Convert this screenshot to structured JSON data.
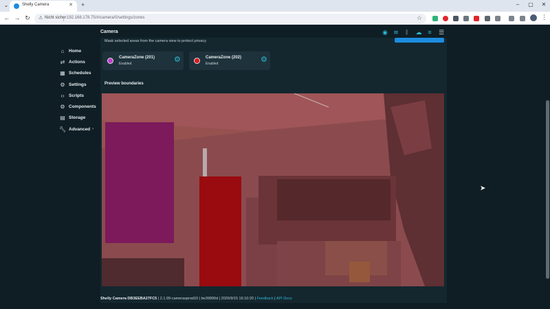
{
  "browser": {
    "tab_title": "Shelly Camera",
    "insecure_label": "Nicht sicher",
    "url": "192.168.178.75/#/camera/0/settings/zones"
  },
  "app": {
    "title": "Camera",
    "status_icons": [
      "wifi-icon",
      "signal-icon",
      "bluetooth-icon",
      "cloud-icon",
      "rss-icon",
      "list-icon"
    ]
  },
  "sidebar": {
    "items": [
      {
        "label": "Home",
        "icon": "home-icon"
      },
      {
        "label": "Actions",
        "icon": "actions-icon"
      },
      {
        "label": "Schedules",
        "icon": "calendar-icon"
      },
      {
        "label": "Settings",
        "icon": "gear-icon"
      },
      {
        "label": "Scripts",
        "icon": "code-icon"
      },
      {
        "label": "Components",
        "icon": "components-icon"
      },
      {
        "label": "Storage",
        "icon": "storage-icon"
      },
      {
        "label": "Advanced",
        "icon": "wrench-icon"
      }
    ]
  },
  "zones": {
    "notice": "Mask selected areas from the camera view to protect privacy",
    "cards": [
      {
        "name": "CameraZone (201)",
        "status": "Enabled",
        "color": "#c23ccf"
      },
      {
        "name": "CameraZone (202)",
        "status": "Enabled",
        "color": "#e01520"
      }
    ]
  },
  "preview": {
    "title": "Preview boundaries",
    "mask_colors": {
      "zone_201": "#7c1a5b",
      "zone_202": "#9a0b10"
    }
  },
  "footer": {
    "device": "Shelly Camera DB3EEBA27FC5",
    "version": "2.1.99-camerasprod10",
    "build": "be39890d",
    "datetime": "2026/9/15 16:10:20",
    "feedback": "Feedback",
    "api_docs": "API Docs"
  },
  "colors": {
    "accent": "#2fb7d3",
    "button": "#1d8ce0",
    "background": "#0f1e25"
  }
}
